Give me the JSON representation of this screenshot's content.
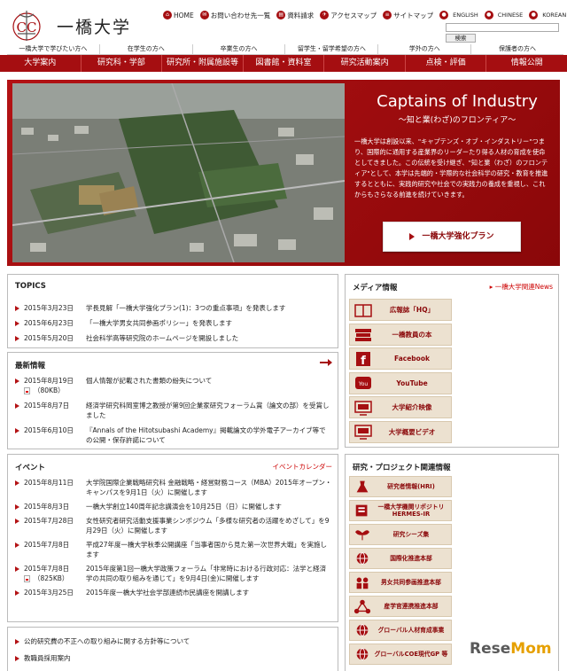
{
  "brand": {
    "name": "一橋大学",
    "logo_letters": "CC"
  },
  "topnav": [
    {
      "label": "HOME",
      "icon": "home-icon",
      "glyph": "⌂"
    },
    {
      "label": "お問い合わせ先一覧",
      "icon": "mail-icon",
      "glyph": "✉"
    },
    {
      "label": "資料請求",
      "icon": "document-icon",
      "glyph": "▤"
    },
    {
      "label": "アクセスマップ",
      "icon": "map-icon",
      "glyph": "✈"
    },
    {
      "label": "サイトマップ",
      "icon": "sitemap-icon",
      "glyph": "≡"
    }
  ],
  "languages": [
    "ENGLISH",
    "CHINESE",
    "KOREAN"
  ],
  "search": {
    "button": "検索",
    "placeholder": ""
  },
  "audience_nav": [
    "一橋大学で学びたい方へ",
    "在学生の方へ",
    "卒業生の方へ",
    "留学生・留学希望の方へ",
    "学外の方へ",
    "保護者の方へ"
  ],
  "main_nav": [
    "大学案内",
    "研究科・学部",
    "研究所・附属施設等",
    "図書館・資料室",
    "研究活動案内",
    "点検・評価",
    "情報公開"
  ],
  "hero": {
    "title": "Captains of Industry",
    "subtitle": "〜知と業(わざ)のフロンティア〜",
    "description": "一橋大学は創設以来、\"キャプテンズ・オブ・インダストリー\"つまり、国際的に通用する産業界のリーダーたり得る人材の育成を使命としてきました。この伝統を受け継ぎ、\"知と業（わざ）のフロンティア\"として、本学は先端的・学際的な社会科学の研究・教育を推進するとともに、実践的研究や社会での実践力の養成を重視し、これからもさらなる前進を続けていきます。",
    "button": "一橋大学強化プラン"
  },
  "topics": {
    "heading": "TOPICS",
    "items": [
      {
        "date": "2015年3月23日",
        "text": "学長見解「一橋大学強化プラン(1)：3つの重点事項」を発表します"
      },
      {
        "date": "2015年6月23日",
        "text": "「一橋大学男女共同参画ポリシー」を発表します"
      },
      {
        "date": "2015年5月20日",
        "text": "社会科学高等研究院のホームページを開設しました"
      }
    ]
  },
  "news": {
    "heading": "最新情報",
    "items": [
      {
        "date": "2015年8月19日",
        "text": "個人情報が記載された書類の紛失について",
        "pdf": "（80KB）"
      },
      {
        "date": "2015年8月7日",
        "text": "経済学研究科岡室博之教授が第9回企業家研究フォーラム賞（論文の部）を受賞しました",
        "pdf": ""
      },
      {
        "date": "2015年6月10日",
        "text": "『Annals of the Hitotsubashi Academy』掲載論文の学外電子アーカイブ等での公開・保存許諾について",
        "pdf": ""
      }
    ]
  },
  "events": {
    "heading": "イベント",
    "link": "イベントカレンダー",
    "items": [
      {
        "date": "2015年8月11日",
        "text": "大学院国際企業戦略研究科 金融戦略・経営財務コース（MBA）2015年オープン・キャンパスを9月1日（火）に開催します",
        "pdf": ""
      },
      {
        "date": "2015年8月3日",
        "text": "一橋大学創立140周年記念講演会を10月25日（日）に開催します",
        "pdf": ""
      },
      {
        "date": "2015年7月28日",
        "text": "女性研究者研究活動支援事業シンポジウム「多様な研究者の活躍をめざして」を9月29日（火）に開催します",
        "pdf": ""
      },
      {
        "date": "2015年7月8日",
        "text": "平成27年度一橋大学秋季公開講座「当事者国から見た第一次世界大戦」を実施します",
        "pdf": ""
      },
      {
        "date": "2015年7月8日",
        "text": "2015年度第1回一橋大学政策フォーラム「非常時における行政対応：法学と経済学の共同の取り組みを通じて」を9月4日(金)に開催します",
        "pdf": "（825KB）"
      },
      {
        "date": "2015年3月25日",
        "text": "2015年度一橋大学社会学部連続市民講座を開講します",
        "pdf": ""
      }
    ]
  },
  "bottom_links": [
    "公的研究費の不正への取り組みに関する方針等について",
    "教職員採用案内"
  ],
  "media": {
    "heading": "メディア情報",
    "link": "一橋大学関連News",
    "items": [
      {
        "label": "広報誌「HQ」",
        "icon": "book-icon"
      },
      {
        "label": "一橋教員の本",
        "icon": "books-icon"
      },
      {
        "label": "Facebook",
        "icon": "facebook-icon"
      },
      {
        "label": "YouTube",
        "icon": "youtube-icon"
      },
      {
        "label": "大学紹介映像",
        "icon": "tv-icon"
      },
      {
        "label": "大学概要ビデオ",
        "icon": "tv-icon"
      }
    ]
  },
  "research": {
    "heading": "研究・プロジェクト関連情報",
    "items": [
      {
        "label": "研究者情報(HRI)",
        "icon": "flask-icon"
      },
      {
        "label": "一橋大学機関リポジトリ HERMES-IR",
        "icon": "repository-icon"
      },
      {
        "label": "研究シーズ集",
        "icon": "sprout-icon"
      },
      {
        "label": "国際化推進本部",
        "icon": "globe-icon"
      },
      {
        "label": "男女共同参画推進本部",
        "icon": "people-icon"
      },
      {
        "label": "産学官連携推進本部",
        "icon": "network-icon"
      },
      {
        "label": "グローバル人材育成事業",
        "icon": "globe-icon"
      },
      {
        "label": "グローバルCOE現代GP 等",
        "icon": "globe-icon"
      }
    ]
  },
  "watermark": {
    "a": "Rese",
    "b": "Mom"
  },
  "colors": {
    "accent": "#a50e11",
    "side_button": "#ece1d0"
  }
}
